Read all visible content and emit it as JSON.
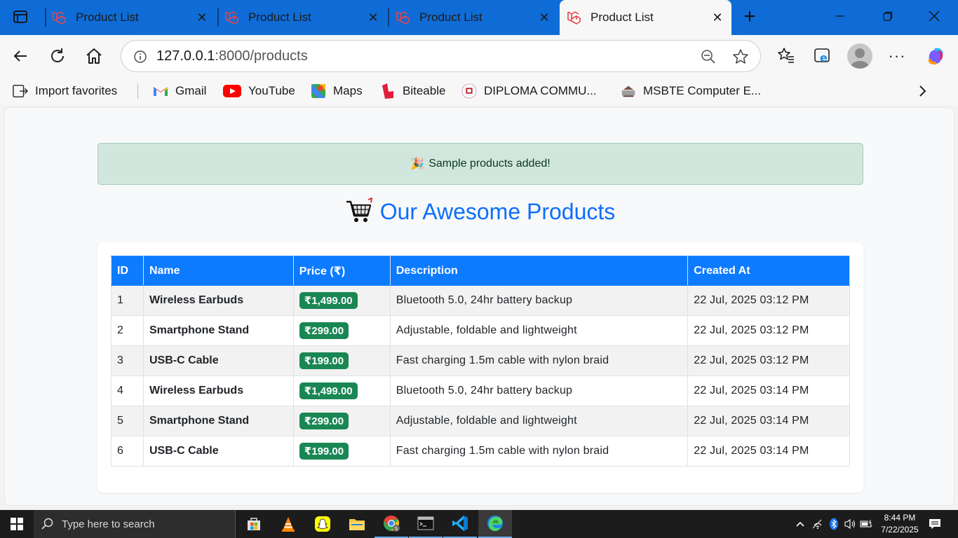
{
  "browser": {
    "tabs": [
      {
        "title": "Product List",
        "active": false
      },
      {
        "title": "Product List",
        "active": false
      },
      {
        "title": "Product List",
        "active": false
      },
      {
        "title": "Product List",
        "active": true
      }
    ],
    "address": {
      "host": "127.0.0.1",
      "rest": ":8000/products"
    },
    "favorites": [
      {
        "label": "Import favorites",
        "icon": "import-icon"
      },
      {
        "label": "Gmail",
        "icon": "gmail-icon"
      },
      {
        "label": "YouTube",
        "icon": "youtube-icon"
      },
      {
        "label": "Maps",
        "icon": "maps-icon"
      },
      {
        "label": "Biteable",
        "icon": "biteable-icon"
      },
      {
        "label": "DIPLOMA COMMU...",
        "icon": "diploma-site-icon"
      },
      {
        "label": "MSBTE Computer E...",
        "icon": "msbte-site-icon"
      }
    ]
  },
  "page": {
    "alert_icon": "🎉",
    "alert_text": "Sample products added!",
    "heading_icon": "shopping-cart-icon",
    "heading": "Our Awesome Products",
    "table": {
      "headers": [
        "ID",
        "Name",
        "Price (₹)",
        "Description",
        "Created At"
      ],
      "rows": [
        {
          "id": "1",
          "name": "Wireless Earbuds",
          "price": "₹1,499.00",
          "description": "Bluetooth 5.0, 24hr battery backup",
          "created": "22 Jul, 2025 03:12 PM"
        },
        {
          "id": "2",
          "name": "Smartphone Stand",
          "price": "₹299.00",
          "description": "Adjustable, foldable and lightweight",
          "created": "22 Jul, 2025 03:12 PM"
        },
        {
          "id": "3",
          "name": "USB-C Cable",
          "price": "₹199.00",
          "description": "Fast charging 1.5m cable with nylon braid",
          "created": "22 Jul, 2025 03:12 PM"
        },
        {
          "id": "4",
          "name": "Wireless Earbuds",
          "price": "₹1,499.00",
          "description": "Bluetooth 5.0, 24hr battery backup",
          "created": "22 Jul, 2025 03:14 PM"
        },
        {
          "id": "5",
          "name": "Smartphone Stand",
          "price": "₹299.00",
          "description": "Adjustable, foldable and lightweight",
          "created": "22 Jul, 2025 03:14 PM"
        },
        {
          "id": "6",
          "name": "USB-C Cable",
          "price": "₹199.00",
          "description": "Fast charging 1.5m cable with nylon braid",
          "created": "22 Jul, 2025 03:14 PM"
        }
      ]
    }
  },
  "taskbar": {
    "search_placeholder": "Type here to search",
    "time": "8:44 PM",
    "date": "7/22/2025"
  },
  "colors": {
    "tabstrip": "#0f6cd6",
    "heading": "#0d6efd",
    "table_header": "#0d7bff",
    "price_badge": "#198754",
    "alert_bg": "#d1e7dd"
  }
}
